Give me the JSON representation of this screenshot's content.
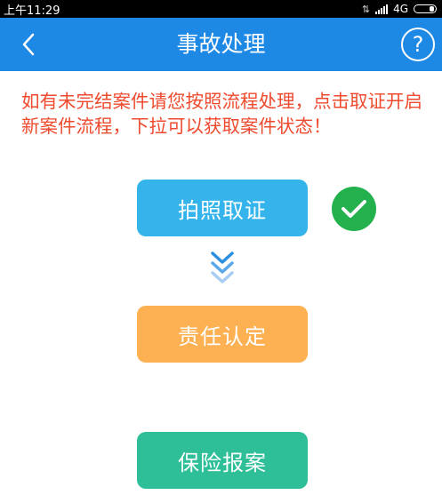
{
  "status_bar": {
    "time": "上午11:29",
    "network": "4G",
    "icons": [
      "sync-icon",
      "signal-icon",
      "battery-icon"
    ]
  },
  "header": {
    "title": "事故处理",
    "back_icon": "chevron-left-icon",
    "help_label": "?",
    "background": "#1e88e5"
  },
  "notice": {
    "text": "如有未完结案件请您按照流程处理，点击取证开启新案件流程，下拉可以获取案件状态！",
    "color": "#ee4a2e"
  },
  "steps": [
    {
      "label": "拍照取证",
      "color": "#35b4ec",
      "completed": true,
      "status_icon": "check-circle-icon",
      "status_color": "#23b14d"
    },
    {
      "label": "责任认定",
      "color": "#fdb153",
      "completed": false
    },
    {
      "label": "保险报案",
      "color": "#2fbf98",
      "completed": false
    }
  ],
  "flow_indicator": {
    "icon": "double-chevron-down-icon",
    "color": "#2b8fe0"
  }
}
